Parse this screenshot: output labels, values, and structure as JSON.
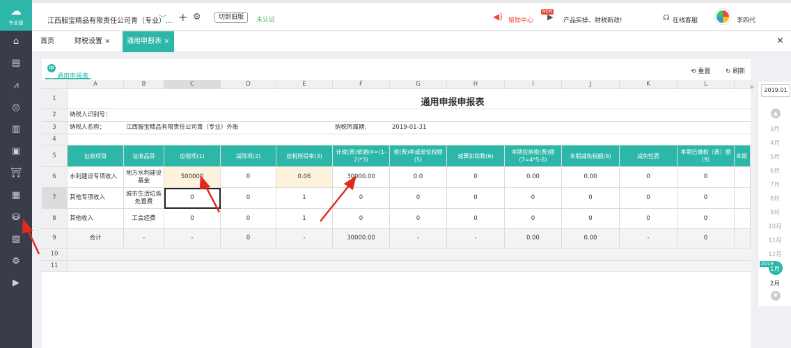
{
  "app": {
    "edition": "专业版"
  },
  "topbar": {
    "company": "江西服宝精品有限责任公司青（专业）...",
    "switch_label": "切到旧版",
    "unverified": "未认证",
    "help": "帮助中心",
    "new_badge": "NEW",
    "news": "产品实操、财税新政!",
    "support": "在线客服",
    "user": "李四代"
  },
  "tabs": [
    {
      "label": "首页"
    },
    {
      "label": "财税设置 ×"
    },
    {
      "label": "通用申报表 ×"
    }
  ],
  "subtab": {
    "label": "通用申报表",
    "icon_text": "申报"
  },
  "toolbar": {
    "reset": "重置",
    "refresh": "刷新"
  },
  "sheet": {
    "col_letters": [
      "A",
      "B",
      "C",
      "D",
      "E",
      "F",
      "G",
      "H",
      "I",
      "J",
      "K",
      "L"
    ],
    "row_numbers": [
      "1",
      "2",
      "3",
      "4",
      "5",
      "6",
      "7",
      "8",
      "9",
      "10",
      "11"
    ],
    "title": "通用申报申报表",
    "taxpayer_id_label": "纳税人识别号：",
    "taxpayer_name_label": "纳税人名称：",
    "taxpayer_name": "江西服宝精品有限责任公司青（专业）外账",
    "period_label": "纳税所属期:",
    "period": "2019-01-31",
    "headers": [
      "征收项目",
      "征收品目",
      "应税项(1)",
      "减除项(2)",
      "应税所得率(3)",
      "计税(费)依据(4=(1-2)*3)",
      "税(费)率或单位税额(5)",
      "速算扣除数(6)",
      "本期应纳税(费)额(7=4*5-6)",
      "本期减免税额(8)",
      "减免性质",
      "本期已缴税（费）额（9）",
      "本期"
    ],
    "rows": [
      [
        "水利建设专项收入",
        "地方水利建设基金",
        "500000",
        "0",
        "0.06",
        "30000.00",
        "0.0",
        "0",
        "0.00",
        "0.00",
        "0",
        "0"
      ],
      [
        "其他专项收入",
        "城市生活垃圾处置费",
        "0",
        "0",
        "1",
        "0",
        "0",
        "0",
        "0",
        "0",
        "0",
        "0"
      ],
      [
        "其他收入",
        "工会经费",
        "0",
        "0",
        "1",
        "0",
        "0",
        "0",
        "0",
        "0",
        "0",
        "0"
      ],
      [
        "合计",
        "-",
        "-",
        "0",
        "-",
        "30000.00",
        "-",
        "-",
        "0.00",
        "0.00",
        "-",
        "0"
      ]
    ]
  },
  "calendar": {
    "date": "2019.01",
    "year_badge": "2019",
    "months": [
      "3月",
      "4月",
      "5月",
      "6月",
      "7月",
      "8月",
      "9月",
      "10月",
      "11月",
      "12月",
      "1月",
      "2月"
    ]
  },
  "colors": {
    "teal": "#2db7a8",
    "sidebar": "#383d48",
    "accent_red": "#e9493c"
  }
}
